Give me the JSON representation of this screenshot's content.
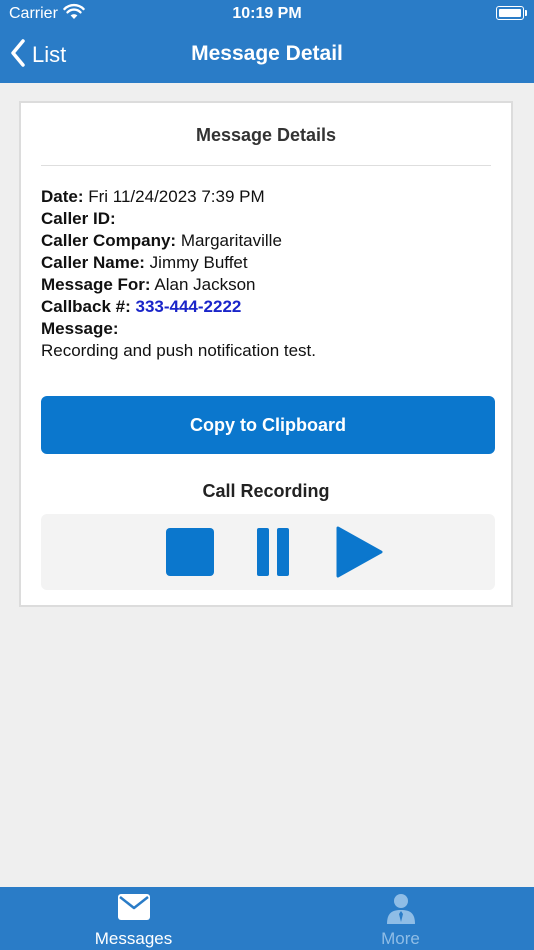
{
  "status_bar": {
    "carrier": "Carrier",
    "time": "10:19 PM"
  },
  "nav": {
    "back_label": "List",
    "title": "Message Detail"
  },
  "card": {
    "title": "Message Details",
    "fields": {
      "date_label": "Date:",
      "date_value": " Fri 11/24/2023 7:39 PM",
      "caller_id_label": "Caller ID:",
      "caller_id_value": "    ",
      "company_label": "Caller Company:",
      "company_value": " Margaritaville",
      "name_label": "Caller Name:",
      "name_value": " Jimmy Buffet",
      "for_label": "Message For:",
      "for_value": " Alan Jackson",
      "callback_label": "Callback #:",
      "callback_value": "333-444-2222",
      "message_label": "Message:",
      "message_value": "Recording and push notification test."
    },
    "copy_button": "Copy to Clipboard",
    "recording_label": "Call Recording"
  },
  "tabs": [
    {
      "label": "Messages",
      "icon": "envelope-icon",
      "active": true
    },
    {
      "label": "More",
      "icon": "person-icon",
      "active": false
    }
  ],
  "colors": {
    "brand": "#2a7cc7",
    "button": "#0b77cd",
    "link": "#1a25c9",
    "inactive_tab": "#8fbde6"
  }
}
